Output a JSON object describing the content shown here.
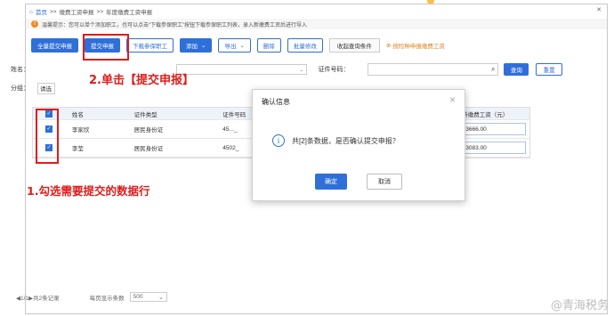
{
  "breadcrumb": {
    "home": "首页",
    "sep": ">>",
    "level1": "缴费工资申报",
    "level2": "年度缴费工资申报"
  },
  "tip": {
    "icon": "!",
    "text": "温馨提示：您可以单个添加职工，也可以点击“下载参保职工”按钮下载参保职工列表，录入新缴费工资后进行导入"
  },
  "toolbar": {
    "btn_submit_all": "全量提交申报",
    "btn_submit": "提交申报",
    "btn_download": "下载参保职工",
    "btn_add": "添加",
    "btn_export": "导出",
    "btn_delete": "删除",
    "btn_batch_edit": "批量修改",
    "tab_collapse": "收起查询条件",
    "link_supplement": "按险种申报缴费工资"
  },
  "filters": {
    "name_label": "姓名：",
    "id_label": "证件号码：",
    "group_label": "分组：",
    "group_value": "请选",
    "search_btn": "查询",
    "reset_btn": "重置"
  },
  "annotations": {
    "step2": "2.单击【提交申报】",
    "step1": "1.勾选需要提交的数据行"
  },
  "table": {
    "headers": [
      "姓名",
      "证件类型",
      "证件号码",
      "新缴费工资（元）"
    ],
    "rows": [
      {
        "name": "李家欣",
        "id_type": "居民身份证",
        "id_no": "45..._",
        "wage": "3666.00"
      },
      {
        "name": "李莹",
        "id_type": "居民身份证",
        "id_no": "4502_",
        "wage": "3083.00"
      }
    ]
  },
  "pagination": {
    "info": "◀1/1▶共2条记录",
    "per_page_label": "每页显示条数",
    "per_page_value": "500"
  },
  "dialog": {
    "title": "确认信息",
    "message": "共[2]条数据，是否确认提交申报？",
    "ok": "确定",
    "cancel": "取消"
  },
  "watermark": "@青海税务",
  "colors": {
    "primary": "#2f6fd9",
    "annotation_red": "#e01b1b",
    "tip_orange": "#f08a24"
  }
}
